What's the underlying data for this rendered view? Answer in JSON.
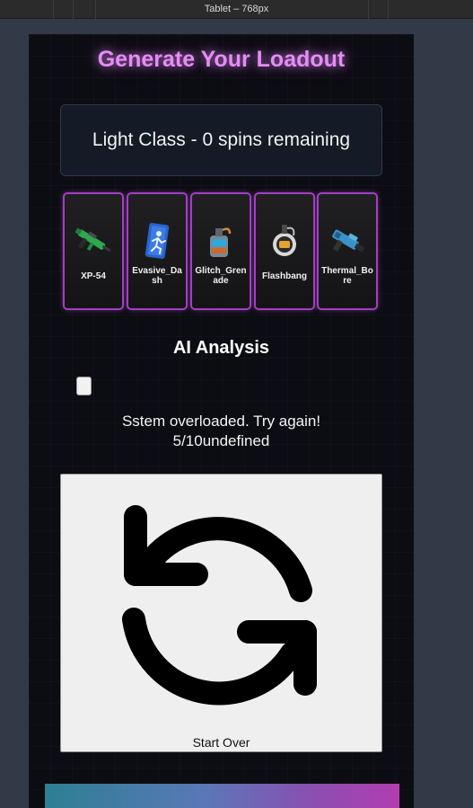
{
  "window": {
    "title": "Tablet – 768px"
  },
  "page": {
    "title": "Generate Your Loadout",
    "class_status": "Light Class - 0 spins remaining"
  },
  "loadout": [
    {
      "name": "XP-54",
      "icon": "smg-icon"
    },
    {
      "name": "Evasive_Dash",
      "icon": "dash-icon"
    },
    {
      "name": "Glitch_Grenade",
      "icon": "grenade-icon"
    },
    {
      "name": "Flashbang",
      "icon": "flashbang-icon"
    },
    {
      "name": "Thermal_Bore",
      "icon": "thermal-bore-icon"
    }
  ],
  "analysis": {
    "title": "AI Analysis",
    "message_line1": "Sstem overloaded. Try again!",
    "message_line2": "5/10undefined"
  },
  "start_over": {
    "label": "Start Over",
    "icon": "refresh-icon"
  },
  "colors": {
    "title_glow": "#e58cf6",
    "card_border": "#a23fc0",
    "background": "#0c0d12"
  }
}
